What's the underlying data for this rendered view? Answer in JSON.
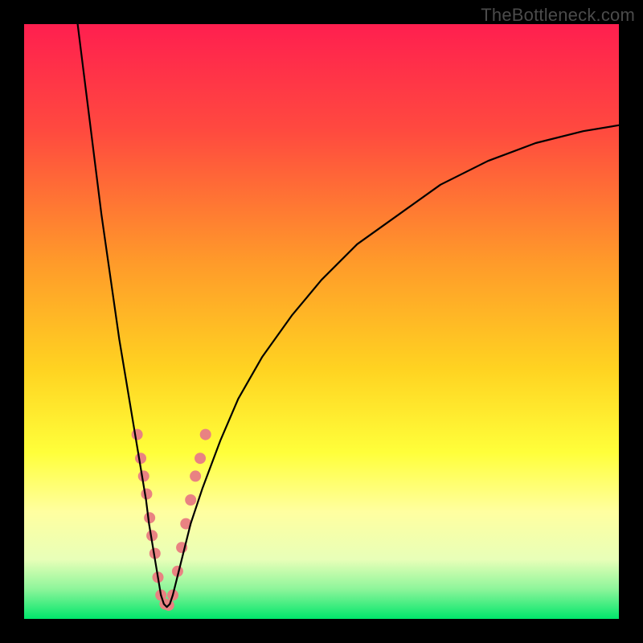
{
  "watermark": "TheBottleneck.com",
  "chart_data": {
    "type": "line",
    "title": "",
    "xlabel": "",
    "ylabel": "",
    "xlim": [
      0,
      100
    ],
    "ylim": [
      0,
      100
    ],
    "gradient_stops": [
      {
        "offset": 0,
        "color": "#ff1f4f"
      },
      {
        "offset": 0.18,
        "color": "#ff4a3f"
      },
      {
        "offset": 0.4,
        "color": "#ff9a2a"
      },
      {
        "offset": 0.58,
        "color": "#ffd321"
      },
      {
        "offset": 0.72,
        "color": "#ffff3a"
      },
      {
        "offset": 0.82,
        "color": "#ffffa0"
      },
      {
        "offset": 0.9,
        "color": "#e8ffb8"
      },
      {
        "offset": 0.95,
        "color": "#8df59a"
      },
      {
        "offset": 1.0,
        "color": "#00e66b"
      }
    ],
    "series": [
      {
        "name": "left-branch",
        "color": "#000000",
        "width": 2.2,
        "x": [
          9,
          10,
          11,
          12,
          13,
          14,
          15,
          16,
          17,
          18,
          19,
          20,
          20.5,
          21,
          21.5,
          22,
          22.5,
          23
        ],
        "y": [
          100,
          92,
          84,
          76,
          68,
          61,
          54,
          47,
          41,
          35,
          29,
          23,
          20,
          16,
          13,
          10,
          7,
          4
        ]
      },
      {
        "name": "right-branch",
        "color": "#000000",
        "width": 2.2,
        "x": [
          25,
          26,
          27,
          28,
          30,
          33,
          36,
          40,
          45,
          50,
          56,
          63,
          70,
          78,
          86,
          94,
          100
        ],
        "y": [
          4,
          8,
          12,
          16,
          22,
          30,
          37,
          44,
          51,
          57,
          63,
          68,
          73,
          77,
          80,
          82,
          83
        ]
      },
      {
        "name": "valley-bottom",
        "color": "#000000",
        "width": 2.2,
        "x": [
          23,
          23.5,
          24,
          24.5,
          25
        ],
        "y": [
          4,
          2.5,
          2,
          2.5,
          4
        ]
      }
    ],
    "markers": {
      "name": "highlight-dots",
      "color": "#e98282",
      "radius": 7,
      "points": [
        {
          "x": 19.0,
          "y": 31
        },
        {
          "x": 19.6,
          "y": 27
        },
        {
          "x": 20.1,
          "y": 24
        },
        {
          "x": 20.6,
          "y": 21
        },
        {
          "x": 21.1,
          "y": 17
        },
        {
          "x": 21.5,
          "y": 14
        },
        {
          "x": 22.0,
          "y": 11
        },
        {
          "x": 22.5,
          "y": 7
        },
        {
          "x": 23.0,
          "y": 4
        },
        {
          "x": 23.7,
          "y": 2.5
        },
        {
          "x": 24.3,
          "y": 2.3
        },
        {
          "x": 25.0,
          "y": 4
        },
        {
          "x": 25.8,
          "y": 8
        },
        {
          "x": 26.5,
          "y": 12
        },
        {
          "x": 27.2,
          "y": 16
        },
        {
          "x": 28.0,
          "y": 20
        },
        {
          "x": 28.8,
          "y": 24
        },
        {
          "x": 29.6,
          "y": 27
        },
        {
          "x": 30.5,
          "y": 31
        }
      ]
    }
  }
}
